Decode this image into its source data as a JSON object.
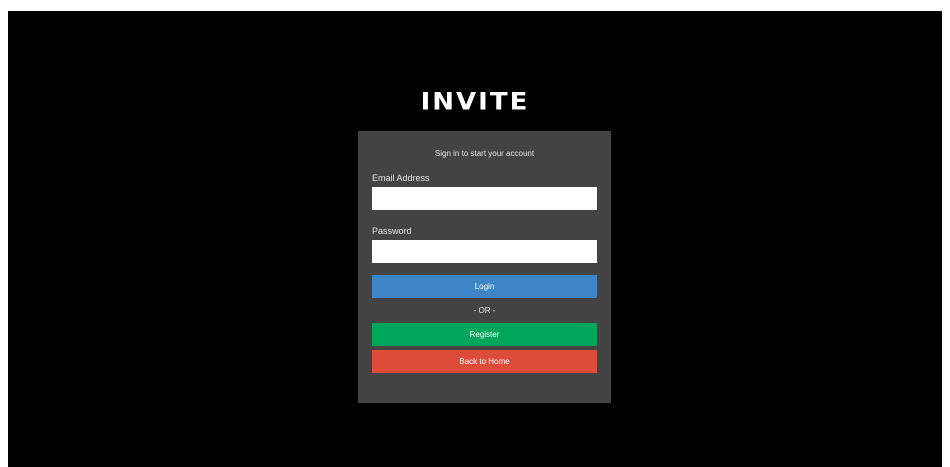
{
  "brand": {
    "title": "INVITE"
  },
  "login_box": {
    "message": "Sign in to start your account",
    "email": {
      "label": "Email Address",
      "value": "",
      "placeholder": ""
    },
    "password": {
      "label": "Password",
      "value": "",
      "placeholder": ""
    },
    "login_button": "Login",
    "separator": "- OR -",
    "register_button": "Register",
    "home_button": "Back to Home"
  },
  "colors": {
    "background": "#000000",
    "panel": "#434343",
    "login": "#3d85c6",
    "register": "#00a65a",
    "home": "#dd4b39"
  }
}
